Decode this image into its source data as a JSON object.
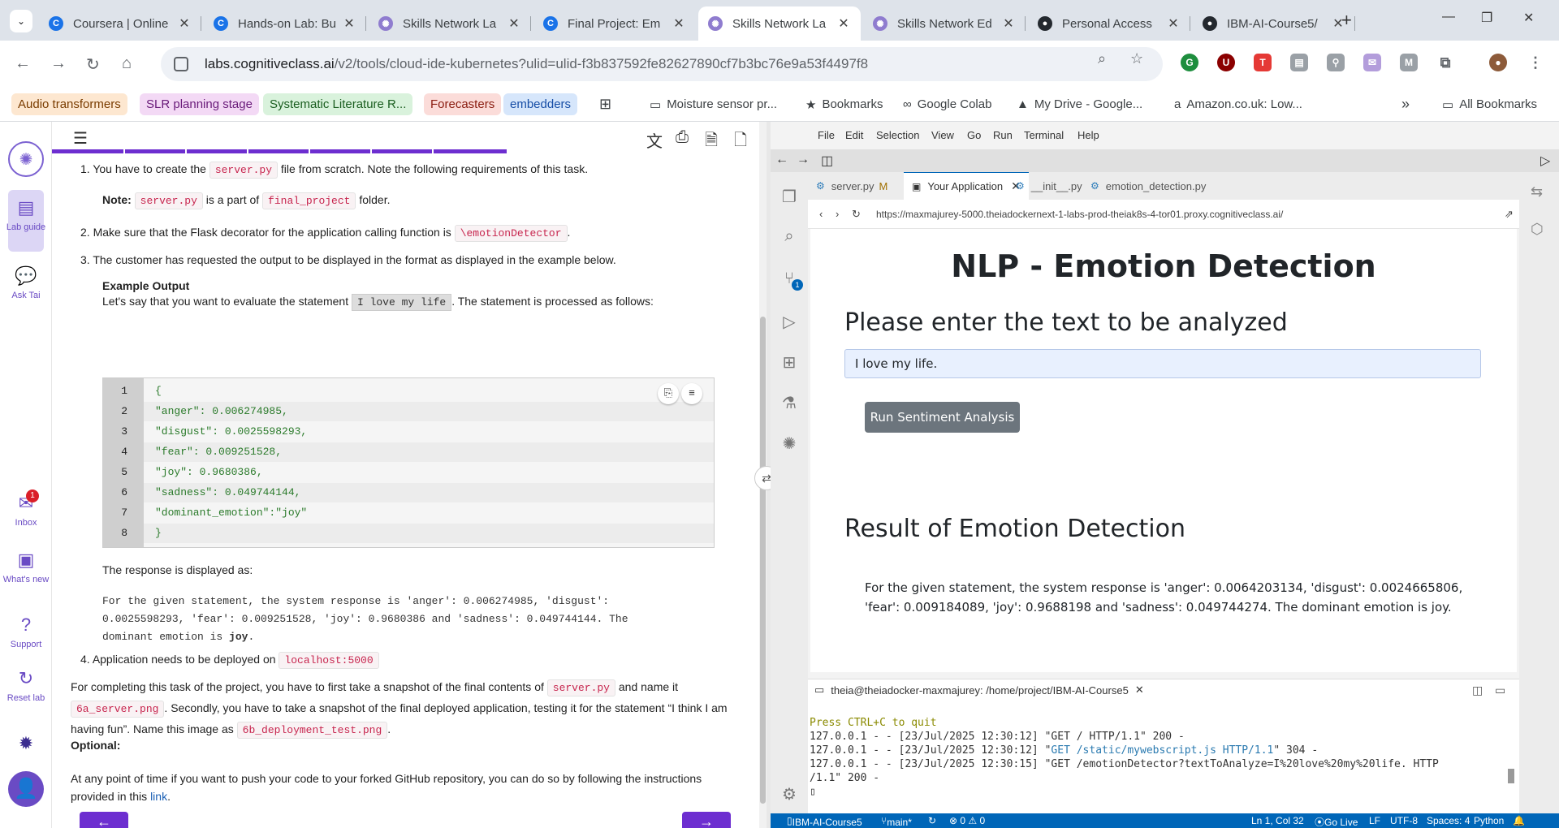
{
  "browser": {
    "tabs": [
      {
        "title": "Coursera | Online",
        "color": "#1a73e8",
        "glyph": "C"
      },
      {
        "title": "Hands-on Lab: Bu",
        "color": "#1a73e8",
        "glyph": "C"
      },
      {
        "title": "Skills Network La",
        "color": "#8f7ccf",
        "glyph": "✺"
      },
      {
        "title": "Final Project: Em",
        "color": "#1a73e8",
        "glyph": "C"
      },
      {
        "title": "Skills Network La",
        "color": "#8f7ccf",
        "glyph": "✺"
      },
      {
        "title": "Skills Network Ed",
        "color": "#8f7ccf",
        "glyph": "✺"
      },
      {
        "title": "Personal Access",
        "color": "#24292f",
        "glyph": "●"
      },
      {
        "title": "IBM-AI-Course5/",
        "color": "#24292f",
        "glyph": "●"
      }
    ],
    "url_domain": "labs.cognitiveclass.ai",
    "url_path": "/v2/tools/cloud-ide-kubernetes?ulid=ulid-f3b837592fe82627890cf7b3bc76e9a53f4497f8",
    "bookmarks": [
      {
        "label": "Audio transformers",
        "bg": "#fde7d0",
        "color": "#7a3c00"
      },
      {
        "label": "SLR planning stage",
        "bg": "#f3d9f5",
        "color": "#6a1b7a"
      },
      {
        "label": "Systematic Literature R...",
        "bg": "#d9f2dc",
        "color": "#1b5e20"
      },
      {
        "label": "Forecasters",
        "bg": "#fbdcd9",
        "color": "#8a1c10"
      },
      {
        "label": "embedders",
        "bg": "#d6e6fb",
        "color": "#174ea6"
      }
    ],
    "bookmarks_plain": [
      {
        "label": "Moisture sensor pr...",
        "icon": "folder-icon",
        "glyph": "▭"
      },
      {
        "label": "Bookmarks",
        "icon": "star-icon",
        "glyph": "★"
      },
      {
        "label": "Google Colab",
        "icon": "colab-icon",
        "glyph": "∞"
      },
      {
        "label": "My Drive - Google...",
        "icon": "drive-icon",
        "glyph": "▲"
      },
      {
        "label": "Amazon.co.uk: Low...",
        "icon": "amazon-icon",
        "glyph": "a"
      }
    ],
    "all_bookmarks": "All Bookmarks"
  },
  "lab_sidebar": {
    "lab_guide": "Lab guide",
    "ask_tai": "Ask Tai",
    "inbox": "Inbox",
    "inbox_count": "1",
    "whats_new": "What's new",
    "support": "Support",
    "reset_lab": "Reset lab"
  },
  "instructions": {
    "step1_a": "You have to create the",
    "step1_code": "server.py",
    "step1_b": "file from scratch. Note the following requirements of this task.",
    "note_label": "Note:",
    "note_code1": "server.py",
    "note_mid": "is a part of",
    "note_code2": "final_project",
    "note_end": "folder.",
    "step2_a": "Make sure that the Flask decorator for the application calling function is",
    "step2_code": "\\emotionDetector",
    "step2_end": ".",
    "step3": "The customer has requested the output to be displayed in the format as displayed in the example below.",
    "example_title": "Example Output",
    "example_a": "Let's say that you want to evaluate the statement",
    "example_code": "I love my life",
    "example_b": ". The statement is processed as follows:",
    "code_lines": [
      "{",
      "\"anger\": 0.006274985,",
      "\"disgust\": 0.0025598293,",
      "\"fear\": 0.009251528,",
      "\"joy\": 0.9680386,",
      "\"sadness\": 0.049744144,",
      "\"dominant_emotion\":\"joy\"",
      "}"
    ],
    "line_numbers": [
      "1",
      "2",
      "3",
      "4",
      "5",
      "6",
      "7",
      "8"
    ],
    "response_label": "The response is displayed as:",
    "response_line1": "For the given statement, the system response is 'anger': 0.006274985, 'disgust':",
    "response_line2": "0.0025598293, 'fear': 0.009251528, 'joy': 0.9680386 and 'sadness': 0.049744144. The",
    "response_line3a": "dominant emotion is ",
    "response_line3b": "joy",
    "response_line3c": ".",
    "step4_a": "Application needs to be deployed on",
    "step4_code": "localhost:5000",
    "complete_a": "For completing this task of the project, you have to first take a snapshot of the final contents of",
    "complete_code1": "server.py",
    "complete_b": "and name it",
    "complete_code2": "6a_server.png",
    "complete_c": ". Secondly, you have to take a snapshot of the final deployed application, testing it for the statement “I think I",
    "complete_d": "am having fun”. Name this image as",
    "complete_code3": "6b_deployment_test.png",
    "complete_e": ".",
    "optional_label": "Optional:",
    "optional_a": "At any point of time if you want to push your code to your forked GitHub repository, you can do so by following the instructions",
    "optional_b": "provided in this",
    "optional_link": "link",
    "optional_end": "."
  },
  "ide": {
    "menu": [
      "File",
      "Edit",
      "Selection",
      "View",
      "Go",
      "Run",
      "Terminal",
      "Help"
    ],
    "tabs": [
      {
        "label": "server.py",
        "mod": "M"
      },
      {
        "label": "Your Application",
        "mod": ""
      },
      {
        "label": "__init__.py",
        "mod": ""
      },
      {
        "label": "emotion_detection.py",
        "mod": ""
      }
    ],
    "preview_url": "https://maxmajurey-5000.theiadockernext-1-labs-prod-theiak8s-4-tor01.proxy.cognitiveclass.ai/",
    "scm_badge": "1",
    "app": {
      "title": "NLP - Emotion Detection",
      "prompt": "Please enter the text to be analyzed",
      "input_value": "I love my life.",
      "button": "Run Sentiment Analysis",
      "result_heading": "Result of Emotion Detection",
      "result_text": "For the given statement, the system response is 'anger': 0.0064203134, 'disgust': 0.0024665806, 'fear': 0.009184089, 'joy': 0.9688198 and 'sadness': 0.049744274. The dominant emotion is joy."
    },
    "terminal": {
      "tab": "theia@theiadocker-maxmajurey: /home/project/IBM-AI-Course5",
      "line0": "Press CTRL+C to quit",
      "line1": "127.0.0.1 - - [23/Jul/2025 12:30:12] \"GET / HTTP/1.1\" 200 -",
      "line2a": "127.0.0.1 - - [23/Jul/2025 12:30:12] \"",
      "line2b": "GET /static/mywebscript.js HTTP/1.1",
      "line2c": "\" 304 -",
      "line3": "127.0.0.1 - - [23/Jul/2025 12:30:15] \"GET /emotionDetector?textToAnalyze=I%20love%20my%20life. HTTP",
      "line4": "/1.1\" 200 -"
    },
    "status": {
      "repo": "IBM-AI-Course5",
      "branch": "main*",
      "problems": "⊗ 0 ⚠ 0",
      "cursor": "Ln 1, Col 32",
      "golive": "Go Live",
      "eol": "LF",
      "encoding": "UTF-8",
      "spaces": "Spaces: 4",
      "lang": "Python"
    }
  }
}
